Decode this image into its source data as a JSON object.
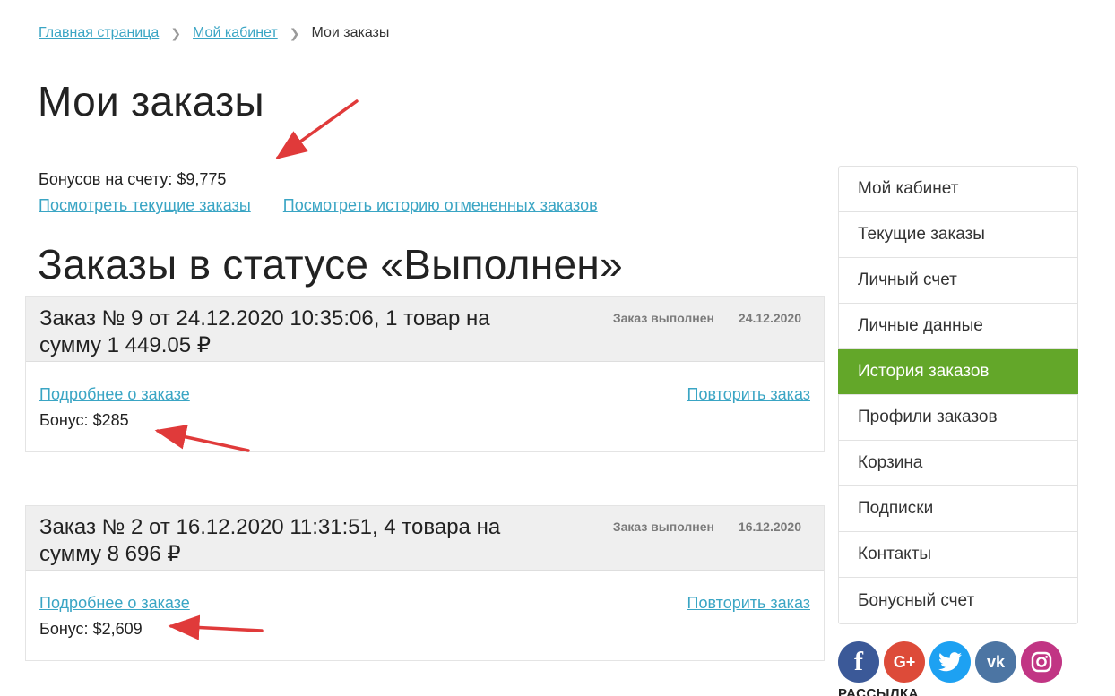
{
  "breadcrumb": {
    "home": "Главная страница",
    "cabinet": "Мой кабинет",
    "current": "Мои заказы",
    "separator": ">"
  },
  "page_title": "Мои заказы",
  "bonus_total": "Бонусов на счету: $9,775",
  "links": {
    "current_orders": "Посмотреть текущие заказы",
    "cancelled_history": "Посмотреть историю отмененных заказов"
  },
  "section_title": "Заказы в статусе «Выполнен»",
  "orders": [
    {
      "title": "Заказ № 9 от 24.12.2020 10:35:06, 1 товар на сумму 1 449.05 ₽",
      "status": "Заказ выполнен",
      "date": "24.12.2020",
      "details_link": "Подробнее о заказе",
      "repeat_link": "Повторить заказ",
      "bonus": "Бонус: $285"
    },
    {
      "title": "Заказ № 2 от 16.12.2020 11:31:51, 4 товара на сумму 8 696 ₽",
      "status": "Заказ выполнен",
      "date": "16.12.2020",
      "details_link": "Подробнее о заказе",
      "repeat_link": "Повторить заказ",
      "bonus": "Бонус: $2,609"
    }
  ],
  "sidebar": {
    "items": [
      {
        "label": "Мой кабинет",
        "active": false
      },
      {
        "label": "Текущие заказы",
        "active": false
      },
      {
        "label": "Личный счет",
        "active": false
      },
      {
        "label": "Личные данные",
        "active": false
      },
      {
        "label": "История заказов",
        "active": true
      },
      {
        "label": "Профили заказов",
        "active": false
      },
      {
        "label": "Корзина",
        "active": false
      },
      {
        "label": "Подписки",
        "active": false
      },
      {
        "label": "Контакты",
        "active": false
      },
      {
        "label": "Бонусный счет",
        "active": false
      }
    ],
    "active_color": "#63a729"
  },
  "socials": [
    {
      "icon": "facebook-icon",
      "glyph": "f",
      "color": "#3b5998"
    },
    {
      "icon": "google-plus-icon",
      "glyph": "G+",
      "color": "#dd4b39"
    },
    {
      "icon": "twitter-icon",
      "glyph": "",
      "color": "#1da1f2"
    },
    {
      "icon": "vk-icon",
      "glyph": "vk",
      "color": "#4c75a3"
    },
    {
      "icon": "instagram-icon",
      "glyph": "",
      "color": "#c13584"
    }
  ],
  "newsletter_heading": "РАССЫЛКА",
  "colors": {
    "link": "#3aa5c4",
    "annotation_arrow": "#e03a3a"
  }
}
